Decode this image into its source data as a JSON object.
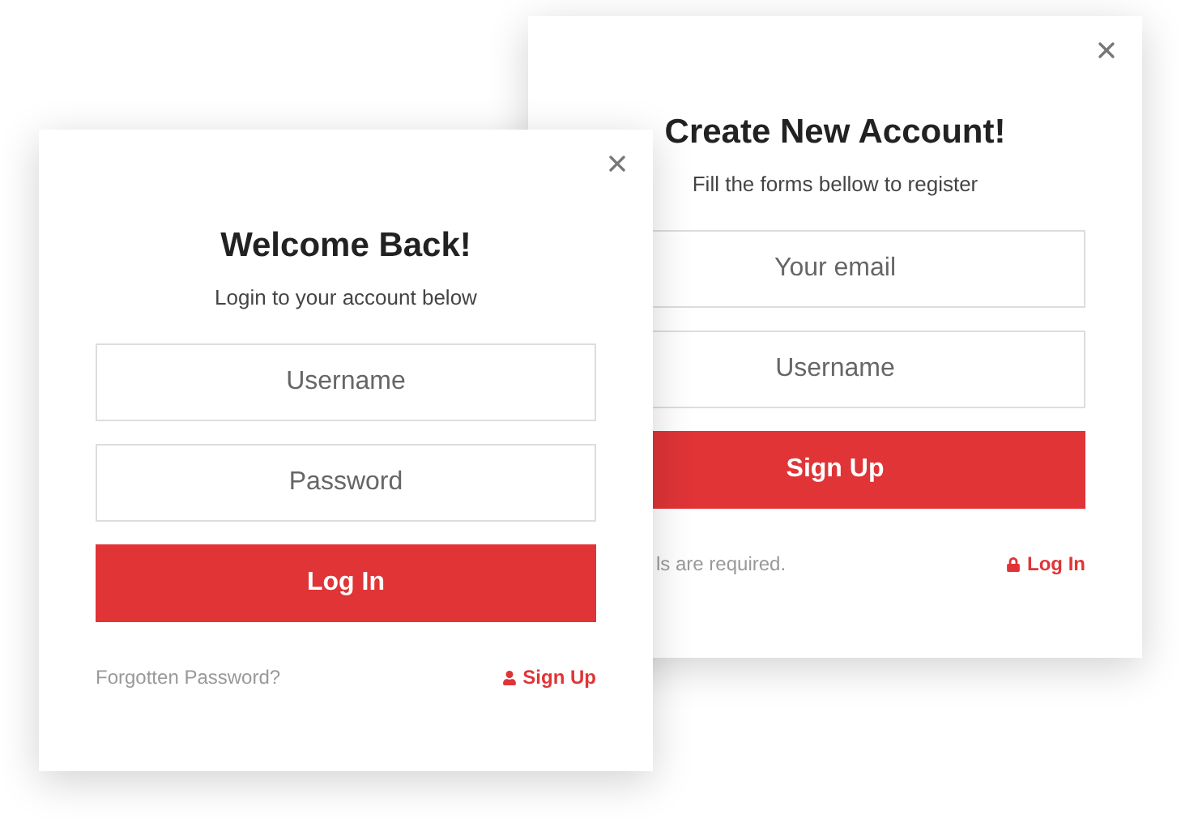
{
  "cards": [
    {
      "title": "Create New Account!",
      "subtitle": "Fill the forms bellow to register",
      "fields": [
        {
          "placeholder": "Your email"
        },
        {
          "placeholder": "Username"
        }
      ],
      "button": "Sign Up",
      "footer_note": "ls are required.",
      "footer_link": {
        "label": "Log In",
        "kind": "login"
      }
    },
    {
      "title": "Welcome Back!",
      "subtitle": "Login to your account below",
      "fields": [
        {
          "placeholder": "Username"
        },
        {
          "placeholder": "Password"
        }
      ],
      "button": "Log In",
      "footer_note": "Forgotten Password?",
      "footer_link": {
        "label": "Sign Up",
        "kind": "signup"
      }
    }
  ]
}
